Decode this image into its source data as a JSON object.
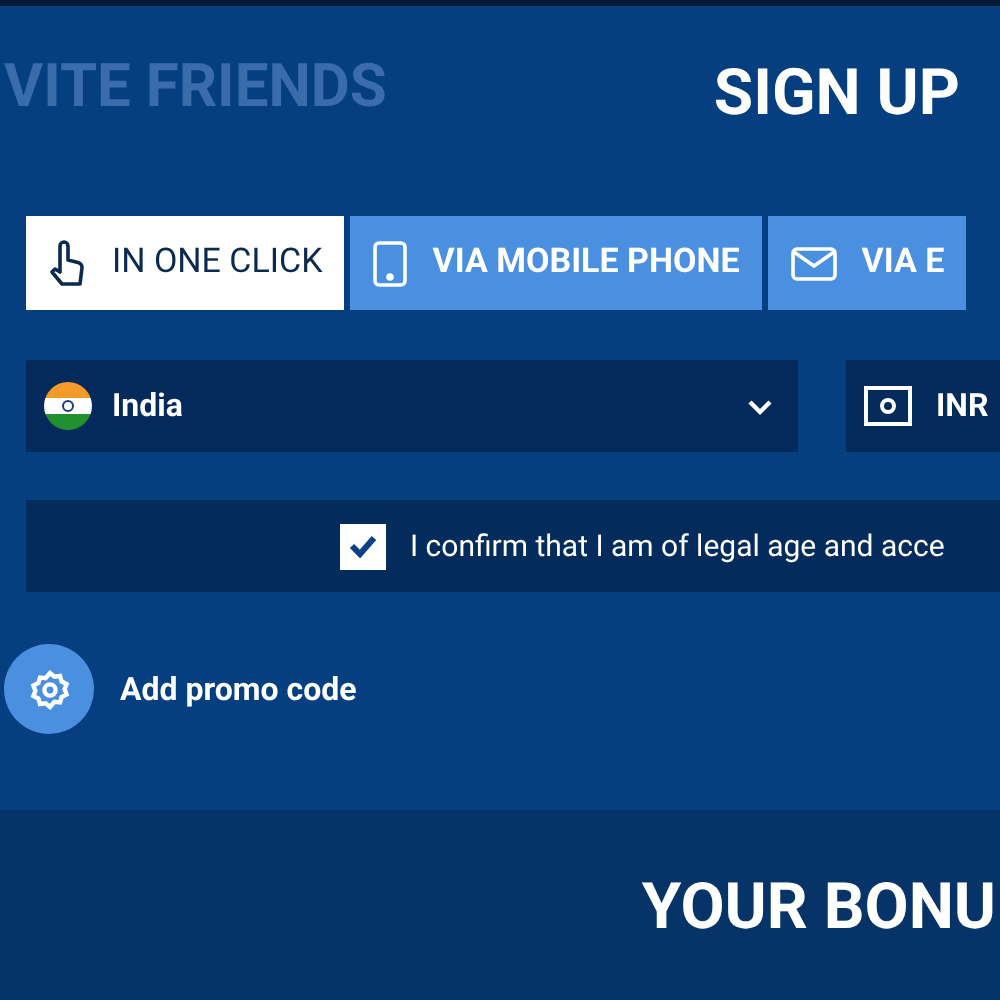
{
  "background_heading": "VITE FRIENDS",
  "title": "SIGN UP",
  "tabs": [
    {
      "label": "IN ONE CLICK",
      "kind": "click",
      "selected": true
    },
    {
      "label": "VIA MOBILE PHONE",
      "kind": "phone",
      "selected": false
    },
    {
      "label": "VIA E",
      "kind": "email",
      "selected": false
    }
  ],
  "country": {
    "value": "India"
  },
  "currency": {
    "value": "INR"
  },
  "confirm": {
    "checked": true,
    "label": "I confirm that I am of legal age and acce"
  },
  "promo": {
    "label": "Add promo code"
  },
  "bonus_heading": "YOUR BONU"
}
